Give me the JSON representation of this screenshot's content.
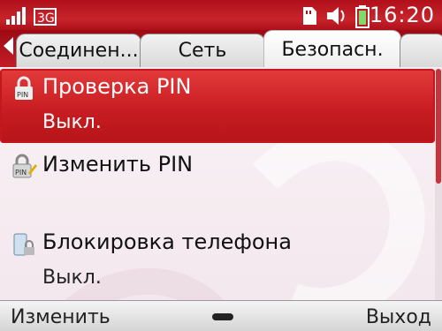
{
  "status": {
    "time": "16:20",
    "icons": [
      "signal-icon",
      "network-3g-icon",
      "memory-card-icon",
      "speaker-icon",
      "battery-icon"
    ]
  },
  "tabs": [
    {
      "label": "Соединен...",
      "active": false
    },
    {
      "label": "Сеть",
      "active": false
    },
    {
      "label": "Безопасн.",
      "active": true
    }
  ],
  "list": [
    {
      "title": "Проверка PIN",
      "value": "Выкл.",
      "icon": "pin-lock-icon",
      "selected": true
    },
    {
      "title": "Изменить PIN",
      "value": "",
      "icon": "pin-edit-icon",
      "selected": false
    },
    {
      "title": "Блокировка телефона",
      "value": "Выкл.",
      "icon": "phone-lock-icon",
      "selected": false
    }
  ],
  "softkeys": {
    "left": "Изменить",
    "right": "Выход"
  },
  "colors": {
    "accent": "#c81d22",
    "header": "#b0101a"
  }
}
